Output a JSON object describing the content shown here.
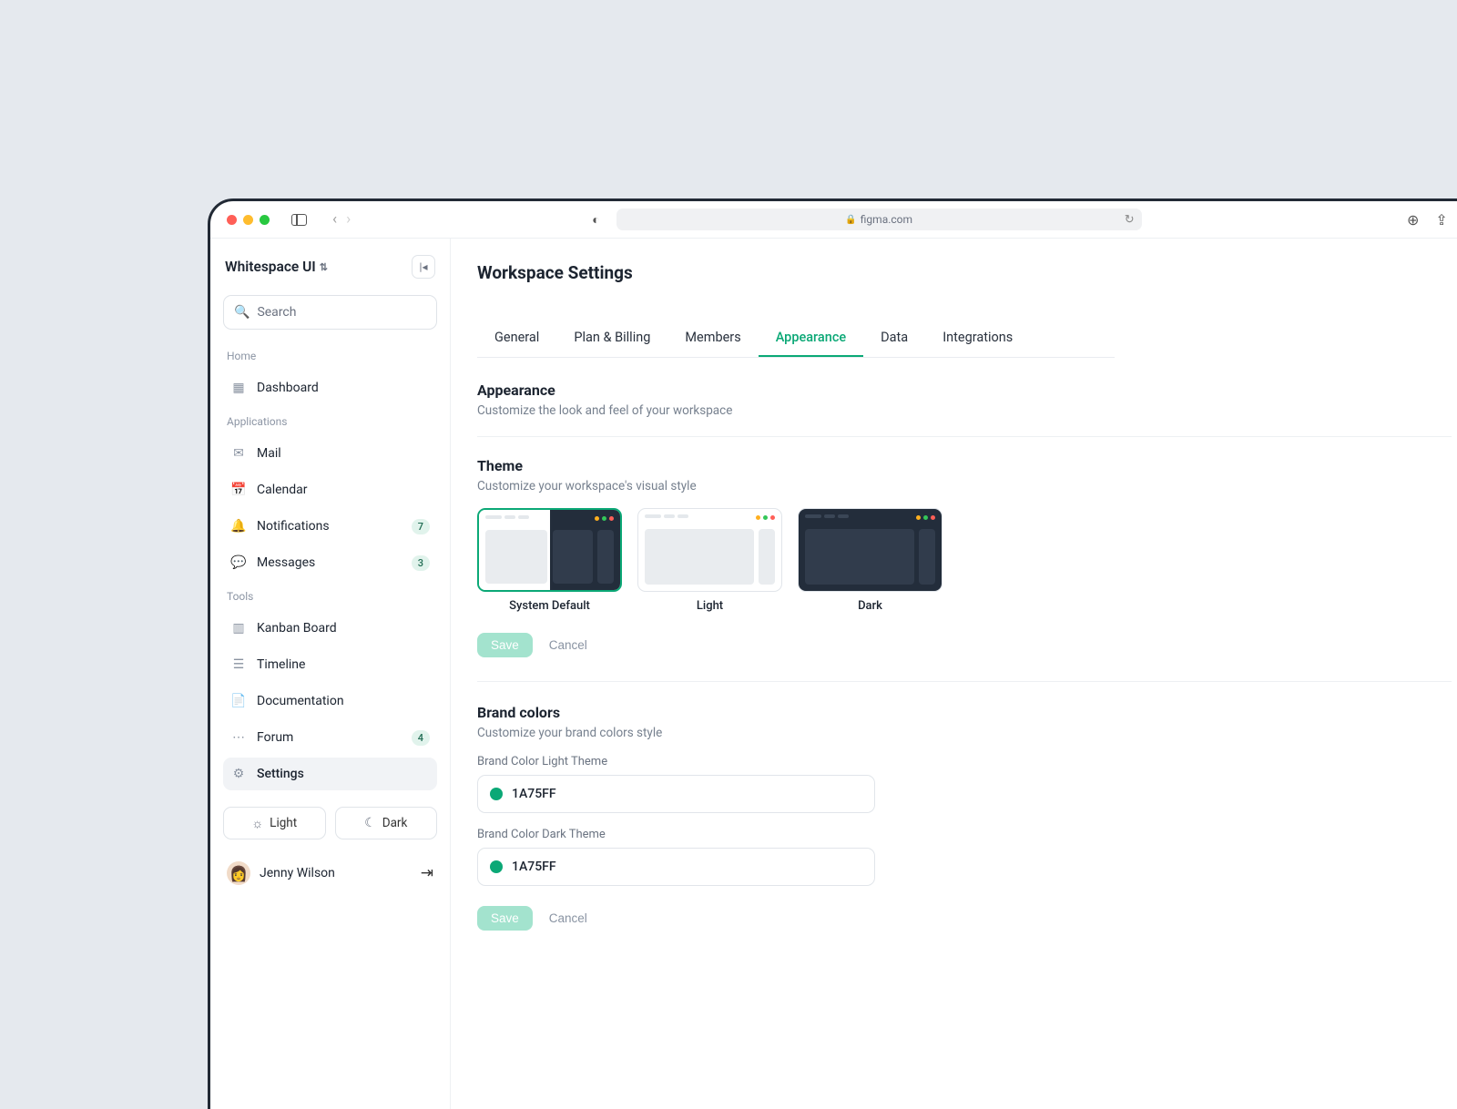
{
  "browser": {
    "url_host": "figma.com"
  },
  "sidebar": {
    "brand": "Whitespace UI",
    "search_placeholder": "Search",
    "sections": {
      "home": "Home",
      "applications": "Applications",
      "tools": "Tools"
    },
    "items": {
      "dashboard": {
        "label": "Dashboard"
      },
      "mail": {
        "label": "Mail"
      },
      "calendar": {
        "label": "Calendar"
      },
      "notifications": {
        "label": "Notifications",
        "badge": "7"
      },
      "messages": {
        "label": "Messages",
        "badge": "3"
      },
      "kanban": {
        "label": "Kanban Board"
      },
      "timeline": {
        "label": "Timeline"
      },
      "documentation": {
        "label": "Documentation"
      },
      "forum": {
        "label": "Forum",
        "badge": "4"
      },
      "settings": {
        "label": "Settings"
      }
    },
    "theme_toggle": {
      "light": "Light",
      "dark": "Dark"
    },
    "user": {
      "name": "Jenny Wilson"
    }
  },
  "main": {
    "page_title": "Workspace Settings",
    "tabs": {
      "general": "General",
      "plan": "Plan & Billing",
      "members": "Members",
      "appearance": "Appearance",
      "data": "Data",
      "integrations": "Integrations"
    },
    "appearance": {
      "title": "Appearance",
      "subtitle": "Customize the look and feel of your workspace"
    },
    "theme": {
      "title": "Theme",
      "subtitle": "Customize your workspace's visual style",
      "options": {
        "system": "System Default",
        "light": "Light",
        "dark": "Dark"
      },
      "save": "Save",
      "cancel": "Cancel"
    },
    "brand": {
      "title": "Brand colors",
      "subtitle": "Customize your brand colors style",
      "light_label": "Brand Color Light Theme",
      "dark_label": "Brand Color Dark Theme",
      "light_value": "1A75FF",
      "dark_value": "1A75FF",
      "swatch_color": "#0ba876",
      "save": "Save",
      "cancel": "Cancel"
    }
  }
}
